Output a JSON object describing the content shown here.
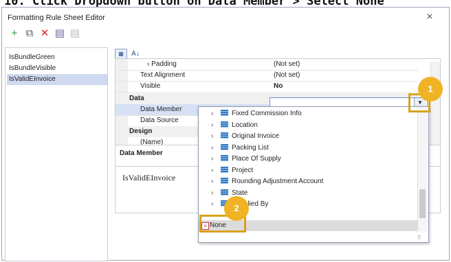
{
  "caption": "10.  Click Dropdown button on Data Member > Select None",
  "window": {
    "title": "Formatting Rule Sheet Editor",
    "close_icon": "×"
  },
  "toolbar": [
    {
      "name": "add-rule-button",
      "icon": "plus-icon",
      "glyph": "+",
      "color": "#1e9a3b"
    },
    {
      "name": "copy-rule-button",
      "icon": "copy-icon",
      "glyph": "⧉",
      "color": "#555"
    },
    {
      "name": "delete-rule-button",
      "icon": "delete-icon",
      "glyph": "✕",
      "color": "#d22"
    },
    {
      "name": "clear-button",
      "icon": "clear-icon",
      "glyph": "▤",
      "color": "#6a6a9a"
    },
    {
      "name": "clear-all-button",
      "icon": "clear-all-icon",
      "glyph": "▤",
      "color": "#bbb"
    }
  ],
  "rules": [
    {
      "label": "IsBundleGreen"
    },
    {
      "label": "IsBundleVisible"
    },
    {
      "label": "IsValidEInvoice"
    }
  ],
  "properties": {
    "padding": {
      "key": "Padding",
      "value": "(Not set)"
    },
    "text_alignment": {
      "key": "Text Alignment",
      "value": "(Not set)"
    },
    "visible": {
      "key": "Visible",
      "value": "No"
    },
    "cat_data": "Data",
    "data_member": {
      "key": "Data Member",
      "value": ""
    },
    "data_source": {
      "key": "Data Source"
    },
    "cat_design": "Design",
    "name": {
      "key": "(Name)"
    }
  },
  "description": {
    "title": "Data Member",
    "text": "IsValidEInvoice"
  },
  "dropdown_items": [
    "Fixed Commission Info",
    "Location",
    "Original Invoice",
    "Packing List",
    "Place Of Supply",
    "Project",
    "Rounding Adjustment Account",
    "State",
    "Supplied By"
  ],
  "none_label": "None",
  "callouts": {
    "one": "1",
    "two": "2"
  },
  "colors": {
    "callout": "#f0b323",
    "selection": "#cfd9ef"
  }
}
